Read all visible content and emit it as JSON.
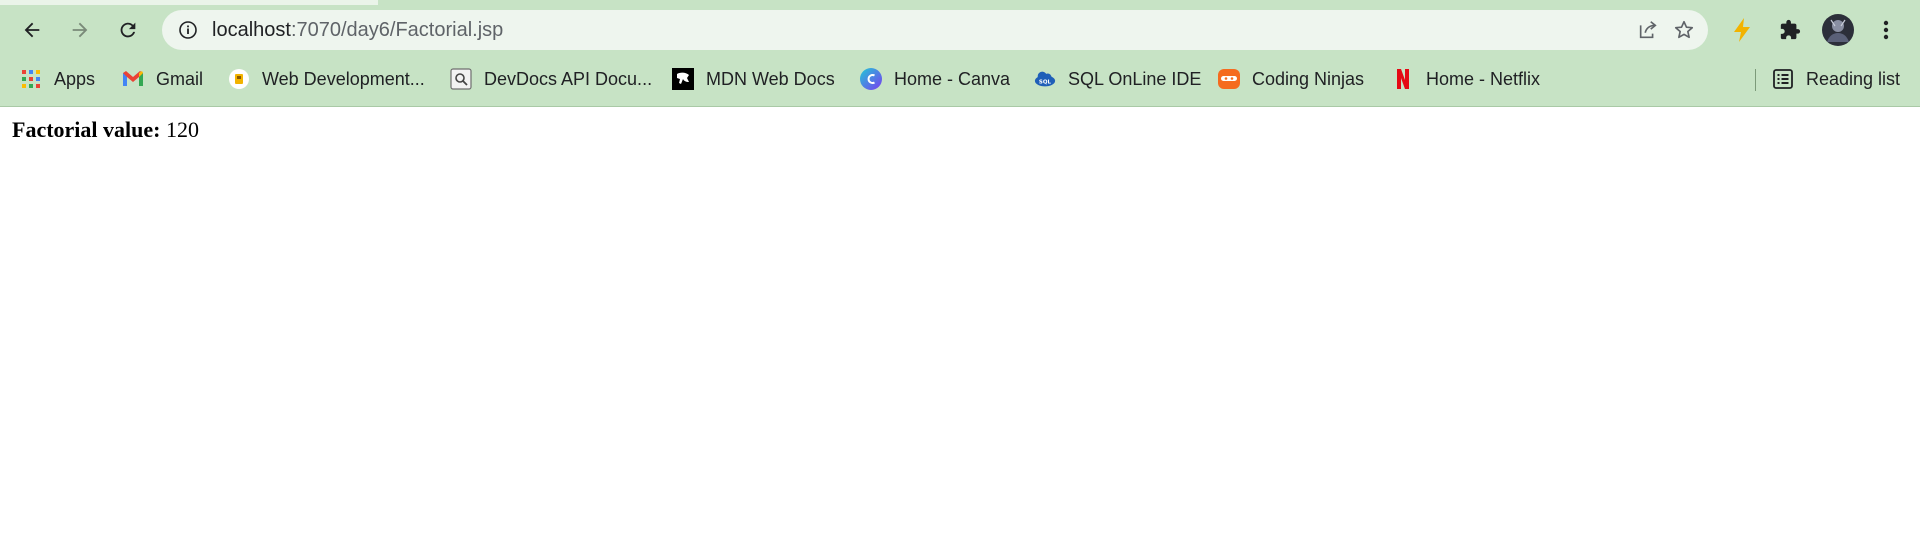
{
  "browser": {
    "url_host": "localhost",
    "url_path": ":7070/day6/Factorial.jsp",
    "bookmarks": [
      {
        "label": "Apps",
        "icon": "apps-grid-icon"
      },
      {
        "label": "Gmail",
        "icon": "gmail-icon"
      },
      {
        "label": "Web Development...",
        "icon": "web-dev-icon"
      },
      {
        "label": "DevDocs API Docu...",
        "icon": "devdocs-icon"
      },
      {
        "label": "MDN Web Docs",
        "icon": "mdn-icon"
      },
      {
        "label": "Home - Canva",
        "icon": "canva-icon"
      },
      {
        "label": "SQL OnLine IDE",
        "icon": "sql-icon"
      },
      {
        "label": "Coding Ninjas",
        "icon": "coding-ninjas-icon"
      },
      {
        "label": "Home - Netflix",
        "icon": "netflix-icon"
      }
    ],
    "reading_list_label": "Reading list",
    "icons": {
      "back": "arrow-left-icon",
      "forward": "arrow-right-icon",
      "reload": "reload-icon",
      "site_info": "info-icon",
      "share": "share-icon",
      "bookmark": "star-icon",
      "extension1": "lightning-icon",
      "extensions": "puzzle-icon",
      "profile": "avatar",
      "menu": "kebab-menu-icon"
    },
    "colors": {
      "frame": "#c7e3c5",
      "omnibox": "#eef5ee",
      "accent": "#f2b300"
    }
  },
  "page": {
    "label": "Factorial value:",
    "value": "120"
  }
}
